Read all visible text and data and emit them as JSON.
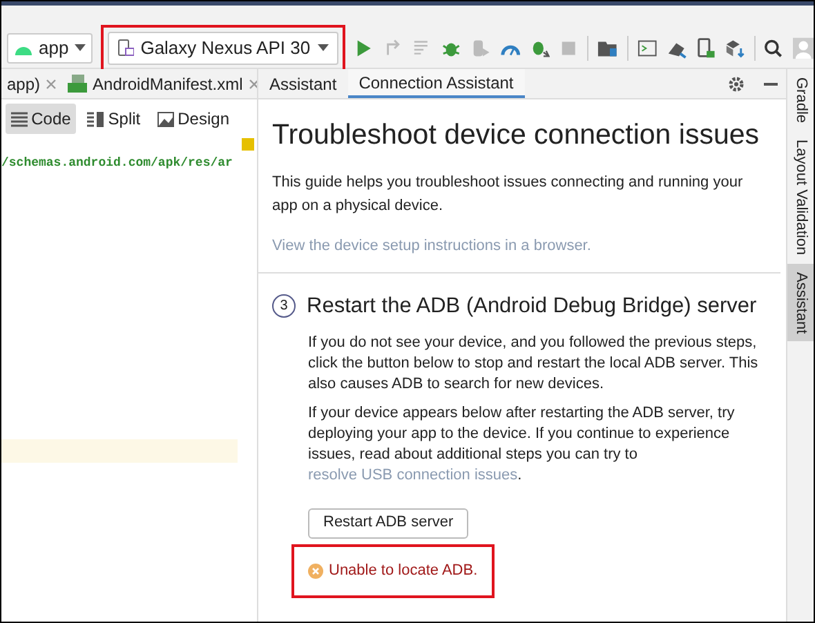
{
  "toolbar": {
    "module": "app",
    "device": {
      "label": "Galaxy Nexus API 30",
      "highlighted": true
    }
  },
  "editor_tabs": [
    {
      "label": "app)",
      "selected": false
    },
    {
      "label": "AndroidManifest.xml",
      "selected": false
    }
  ],
  "view_modes": [
    {
      "label": "Code",
      "selected": true
    },
    {
      "label": "Split",
      "selected": false
    },
    {
      "label": "Design",
      "selected": false
    }
  ],
  "code_line": "/schemas.android.com/apk/res/ar",
  "assistant_tabs": [
    {
      "label": "Assistant",
      "selected": false
    },
    {
      "label": "Connection Assistant",
      "selected": true
    }
  ],
  "side_tabs": [
    {
      "label": "Gradle",
      "selected": false
    },
    {
      "label": "Layout Validation",
      "selected": false
    },
    {
      "label": "Assistant",
      "selected": true
    }
  ],
  "panel": {
    "title": "Troubleshoot device connection issues",
    "intro": "This guide helps you troubleshoot issues connecting and running your app on a physical device.",
    "link": "View the device setup instructions in a browser.",
    "step": {
      "number": "3",
      "title": "Restart the ADB (Android Debug Bridge) server",
      "paragraph_1": "If you do not see your device, and you followed the previous steps, click the button below to stop and restart the local ADB server. This also causes ADB to search for new devices.",
      "paragraph_2": "If your device appears below after restarting the ADB server, try deploying your app to the device. If you continue to experience issues, read about additional steps you can try to ",
      "paragraph_2_link": "resolve USB connection issues",
      "paragraph_2_end": ".",
      "button": "Restart ADB server",
      "error": {
        "text": "Unable to locate ADB.",
        "highlighted": true
      }
    }
  }
}
